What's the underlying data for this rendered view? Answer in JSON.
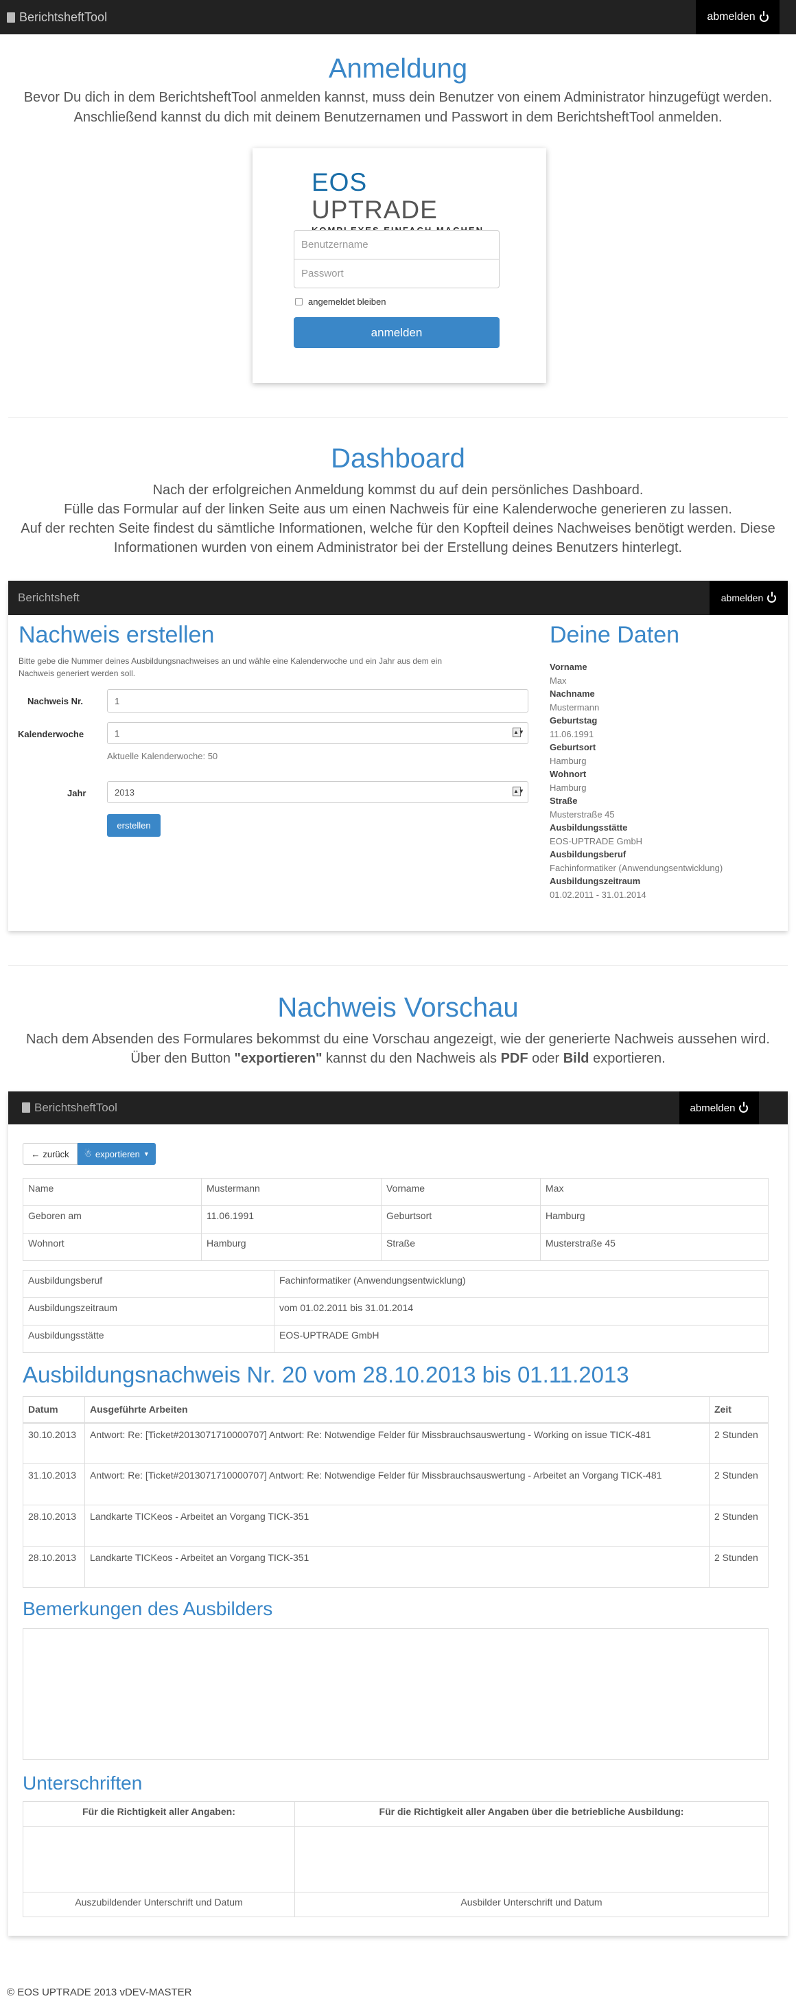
{
  "topnav": {
    "brand": "BerichtsheftTool",
    "logout": "abmelden"
  },
  "login_section": {
    "title": "Anmeldung",
    "line1": "Bevor Du dich in dem BerichtsheftTool anmelden kannst, muss dein Benutzer von einem Administrator hinzugefügt werden.",
    "line2": "Anschließend kannst du dich mit deinem Benutzernamen und Passwort in dem BerichtsheftTool anmelden.",
    "logo_main_a": "EOS",
    "logo_main_b": "UPTRADE",
    "logo_tagline": "KOMPLEXES EINFACH MACHEN.",
    "username_placeholder": "Benutzername",
    "password_placeholder": "Passwort",
    "remember": "angemeldet bleiben",
    "submit": "anmelden"
  },
  "dashboard_section": {
    "title": "Dashboard",
    "line1": "Nach der erfolgreichen Anmeldung kommst du auf dein persönliches Dashboard.",
    "line2": "Fülle das Formular auf der linken Seite aus um einen Nachweis für eine Kalenderwoche generieren zu lassen.",
    "line3": "Auf der rechten Seite findest du sämtliche Informationen, welche für den Kopfteil deines Nachweises benötigt werden. Diese",
    "line4": "Informationen wurden von einem Administrator bei der Erstellung deines Benutzers hinterlegt."
  },
  "dash_nav": {
    "brand": "Berichtsheft",
    "logout": "abmelden"
  },
  "form": {
    "title": "Nachweis erstellen",
    "intro1": "Bitte gebe die Nummer deines Ausbildungsnachweises an und wähle eine Kalenderwoche und ein Jahr aus dem ein",
    "intro2": "Nachweis generiert werden soll.",
    "nr_label": "Nachweis Nr.",
    "nr_value": "1",
    "kw_label": "Kalenderwoche",
    "kw_value": "1",
    "kw_hint": "Aktuelle Kalenderwoche: 50",
    "year_label": "Jahr",
    "year_value": "2013",
    "submit": "erstellen"
  },
  "data_panel": {
    "title": "Deine Daten",
    "items": [
      {
        "label": "Vorname",
        "value": "Max"
      },
      {
        "label": "Nachname",
        "value": "Mustermann"
      },
      {
        "label": "Geburtstag",
        "value": "11.06.1991"
      },
      {
        "label": "Geburtsort",
        "value": "Hamburg"
      },
      {
        "label": "Wohnort",
        "value": "Hamburg"
      },
      {
        "label": "Straße",
        "value": "Musterstraße 45"
      },
      {
        "label": "Ausbildungsstätte",
        "value": "EOS-UPTRADE GmbH"
      },
      {
        "label": "Ausbildungsberuf",
        "value": "Fachinformatiker (Anwendungsentwicklung)"
      },
      {
        "label": "Ausbildungszeitraum",
        "value": "01.02.2011 - 31.01.2014"
      }
    ]
  },
  "preview_section": {
    "title": "Nachweis Vorschau",
    "line1": "Nach dem Absenden des Formulares bekommst du eine Vorschau angezeigt, wie der generierte Nachweis aussehen wird.",
    "line2_a": "Über den Button ",
    "line2_b": "\"exportieren\"",
    "line2_c": " kannst du den Nachweis als ",
    "line2_d": "PDF",
    "line2_e": " oder ",
    "line2_f": "Bild",
    "line2_g": " exportieren."
  },
  "preview_nav": {
    "brand": "BerichtsheftTool",
    "logout": "abmelden"
  },
  "preview": {
    "back": "zurück",
    "export": "exportieren",
    "person_rows": [
      [
        "Name",
        "Mustermann",
        "Vorname",
        "Max"
      ],
      [
        "Geboren am",
        "11.06.1991",
        "Geburtsort",
        "Hamburg"
      ],
      [
        "Wohnort",
        "Hamburg",
        "Straße",
        "Musterstraße 45"
      ]
    ],
    "job_rows": [
      [
        "Ausbildungsberuf",
        "Fachinformatiker (Anwendungsentwicklung)"
      ],
      [
        "Ausbildungszeitraum",
        "vom 01.02.2011 bis 31.01.2014"
      ],
      [
        "Ausbildungsstätte",
        "EOS-UPTRADE GmbH"
      ]
    ],
    "report_title": "Ausbildungsnachweis Nr. 20 vom 28.10.2013 bis 01.11.2013",
    "work_headers": [
      "Datum",
      "Ausgeführte Arbeiten",
      "Zeit"
    ],
    "work_rows": [
      [
        "30.10.2013",
        "Antwort: Re: [Ticket#2013071710000707] Antwort: Re: Notwendige Felder für Missbrauchsauswertung - Working on issue TICK-481",
        "2 Stunden"
      ],
      [
        "31.10.2013",
        "Antwort: Re: [Ticket#2013071710000707] Antwort: Re: Notwendige Felder für Missbrauchsauswertung - Arbeitet an Vorgang TICK-481",
        "2 Stunden"
      ],
      [
        "28.10.2013",
        "Landkarte TICKeos - Arbeitet an Vorgang TICK-351",
        "2 Stunden"
      ],
      [
        "28.10.2013",
        "Landkarte TICKeos - Arbeitet an Vorgang TICK-351",
        "2 Stunden"
      ]
    ],
    "remarks_title": "Bemerkungen des Ausbilders",
    "sign_title": "Unterschriften",
    "sign_head_left": "Für die Richtigkeit aller Angaben:",
    "sign_head_right": "Für die Richtigkeit aller Angaben über die betriebliche Ausbildung:",
    "sign_foot_left": "Auszubildender Unterschrift und Datum",
    "sign_foot_right": "Ausbilder Unterschrift und Datum"
  },
  "footer": {
    "text": "© EOS UPTRADE 2013 vDEV-MASTER"
  },
  "colors": {
    "accent": "#3a87c8",
    "navbar": "#222222"
  }
}
